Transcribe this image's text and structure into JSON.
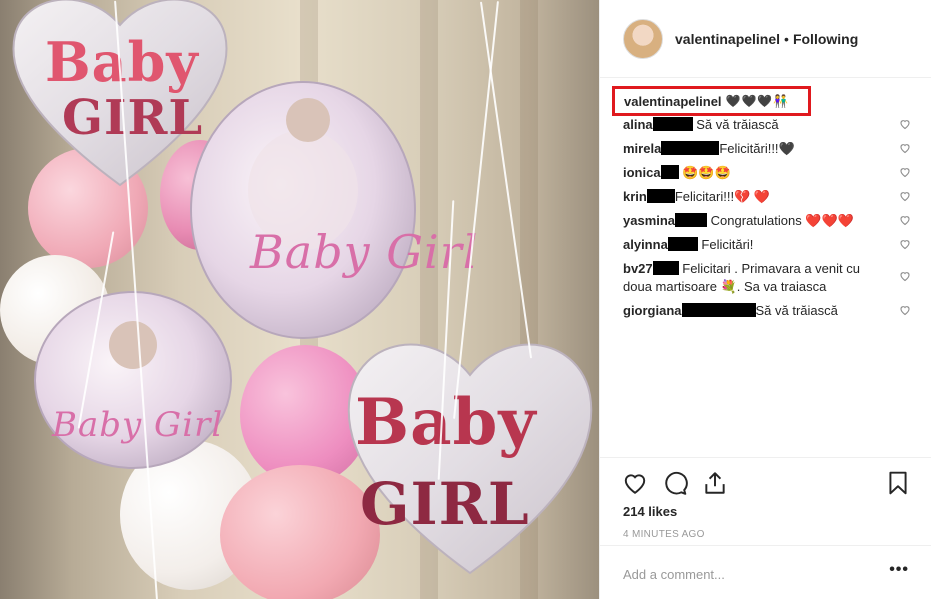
{
  "post": {
    "username": "valentinapelinel",
    "separator": "•",
    "follow_status": "Following",
    "caption_text": "🖤🖤🖤👫",
    "likes": "214 likes",
    "timestamp": "4 MINUTES AGO",
    "add_comment_placeholder": "Add a comment...",
    "more_options": "•••"
  },
  "photo": {
    "balloon_texts": [
      "Baby",
      "GIRL",
      "Baby Girl",
      "Baby",
      "GIRL",
      "Baby Girl"
    ]
  },
  "comments": [
    {
      "user": "alina",
      "text": " Să vă trăiască"
    },
    {
      "user": "mirela",
      "text": "Felicitări!!!🖤"
    },
    {
      "user": "ionica",
      "text": " 🤩🤩🤩"
    },
    {
      "user": "krin",
      "text": "Felicitari!!!💔 ❤️"
    },
    {
      "user": "yasmina",
      "text": " Congratulations ❤️❤️❤️"
    },
    {
      "user": "alyinna",
      "text": " Felicitări!"
    },
    {
      "user": "bv27",
      "text": " Felicitari . Primavara a venit cu doua martisoare 💐. Sa va traiasca"
    },
    {
      "user": "giorgiana",
      "text": "Să vă trăiască"
    }
  ],
  "icons": {
    "like": "heart-outline-icon",
    "comment": "speech-bubble-icon",
    "share": "share-upload-icon",
    "save": "bookmark-icon",
    "comment_like": "heart-outline-icon"
  },
  "colors": {
    "highlight": "#e0191e",
    "text": "#262626",
    "muted": "#999999"
  }
}
